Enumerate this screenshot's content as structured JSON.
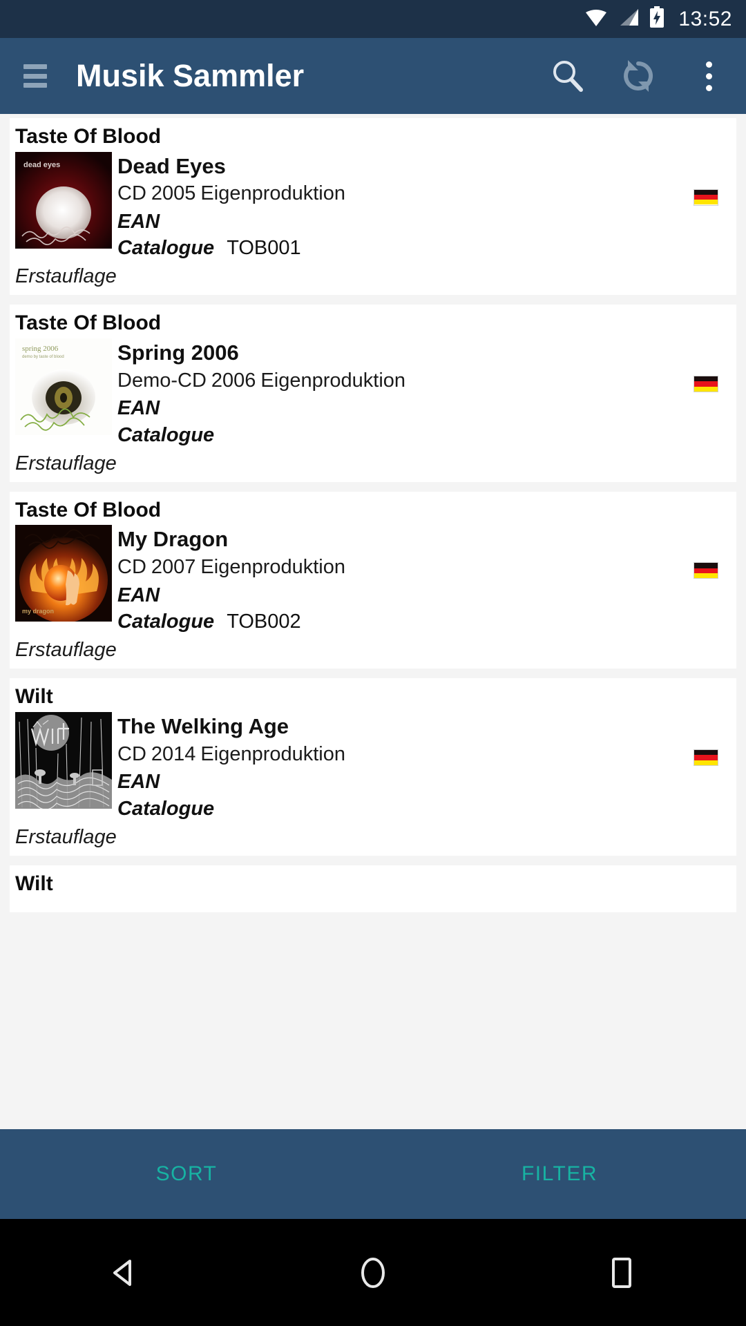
{
  "status_bar": {
    "time": "13:52",
    "icons": [
      "wifi-icon",
      "signal-icon",
      "battery-charging-icon"
    ]
  },
  "app_bar": {
    "title": "Musik Sammler",
    "menu_icon": "hamburger-menu-icon",
    "actions": [
      {
        "name": "search-icon",
        "label": "Search"
      },
      {
        "name": "refresh-icon",
        "label": "Refresh"
      },
      {
        "name": "overflow-menu-icon",
        "label": "More options"
      }
    ]
  },
  "labels": {
    "ean": "EAN",
    "catalogue": "Catalogue",
    "edition": "Erstauflage"
  },
  "colors": {
    "app_bar": "#2d5073",
    "status_bar": "#1d3148",
    "accent": "#17b3a3",
    "list_background": "#f4f4f4",
    "card": "#ffffff",
    "flag_black": "#1a0d0d",
    "flag_red": "#e8131b",
    "flag_gold": "#ffe500"
  },
  "releases": [
    {
      "artist": "Taste Of Blood",
      "title": "Dead Eyes",
      "format": "CD",
      "year": "2005",
      "label": "Eigenproduktion",
      "ean": "",
      "catalogue": "TOB001",
      "edition": "Erstauflage",
      "country_flag": "germany-flag-icon",
      "cover": "dead-eyes-cover"
    },
    {
      "artist": "Taste Of Blood",
      "title": "Spring 2006",
      "format": "Demo-CD",
      "year": "2006",
      "label": "Eigenproduktion",
      "ean": "",
      "catalogue": "",
      "edition": "Erstauflage",
      "country_flag": "germany-flag-icon",
      "cover": "spring-2006-cover"
    },
    {
      "artist": "Taste Of Blood",
      "title": "My Dragon",
      "format": "CD",
      "year": "2007",
      "label": "Eigenproduktion",
      "ean": "",
      "catalogue": "TOB002",
      "edition": "Erstauflage",
      "country_flag": "germany-flag-icon",
      "cover": "my-dragon-cover"
    },
    {
      "artist": "Wilt",
      "title": "The Welking Age",
      "format": "CD",
      "year": "2014",
      "label": "Eigenproduktion",
      "ean": "",
      "catalogue": "",
      "edition": "Erstauflage",
      "country_flag": "germany-flag-icon",
      "cover": "welking-age-cover"
    },
    {
      "artist": "Wilt",
      "title": "",
      "format": "",
      "year": "",
      "label": "",
      "ean": "",
      "catalogue": "",
      "edition": "",
      "country_flag": "",
      "cover": ""
    }
  ],
  "bottom_bar": {
    "sort_label": "SORT",
    "filter_label": "FILTER"
  },
  "nav_bar": {
    "back": "back-triangle-icon",
    "home": "home-circle-icon",
    "recents": "recents-square-icon"
  }
}
